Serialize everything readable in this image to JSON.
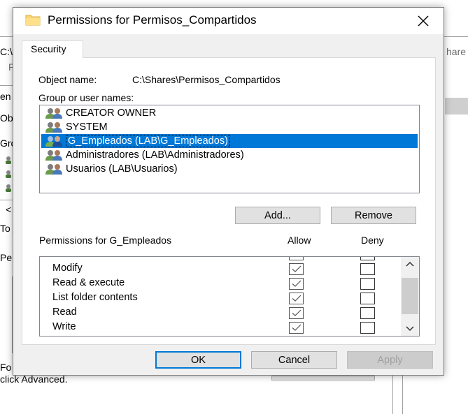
{
  "background": {
    "fragments": [
      "C:\\",
      "P",
      "en",
      "Ob",
      "Gro",
      "<",
      "To",
      "Pe",
      "Fo",
      "click Advanced.",
      "hare"
    ]
  },
  "dialog": {
    "title": "Permissions for Permisos_Compartidos",
    "close_label": "✕",
    "tab_label": "Security",
    "object_name_label": "Object name:",
    "object_name_value": "C:\\Shares\\Permisos_Compartidos",
    "group_label": "Group or user names:",
    "groups": [
      {
        "name": "CREATOR OWNER",
        "selected": false
      },
      {
        "name": "SYSTEM",
        "selected": false
      },
      {
        "name": "G_Empleados (LAB\\G_Empleados)",
        "selected": true
      },
      {
        "name": "Administradores (LAB\\Administradores)",
        "selected": false
      },
      {
        "name": "Usuarios (LAB\\Usuarios)",
        "selected": false
      }
    ],
    "add_label": "Add...",
    "remove_label": "Remove",
    "permissions_label": "Permissions for G_Empleados",
    "allow_label": "Allow",
    "deny_label": "Deny",
    "permissions": [
      {
        "name": "Modify",
        "allow": true,
        "deny": false
      },
      {
        "name": "Read & execute",
        "allow": true,
        "deny": false
      },
      {
        "name": "List folder contents",
        "allow": true,
        "deny": false
      },
      {
        "name": "Read",
        "allow": true,
        "deny": false
      },
      {
        "name": "Write",
        "allow": true,
        "deny": false
      }
    ],
    "ok_label": "OK",
    "cancel_label": "Cancel",
    "apply_label": "Apply"
  },
  "colors": {
    "selection": "#0078d7",
    "dialog_bg": "#f0f0f0",
    "button_bg": "#e1e1e1"
  },
  "icons": {
    "title": "folder-icon",
    "group_item": "users-icon",
    "checkbox_mark": "checkmark-icon",
    "scroll_up": "chevron-up-icon",
    "scroll_down": "chevron-down-icon"
  }
}
